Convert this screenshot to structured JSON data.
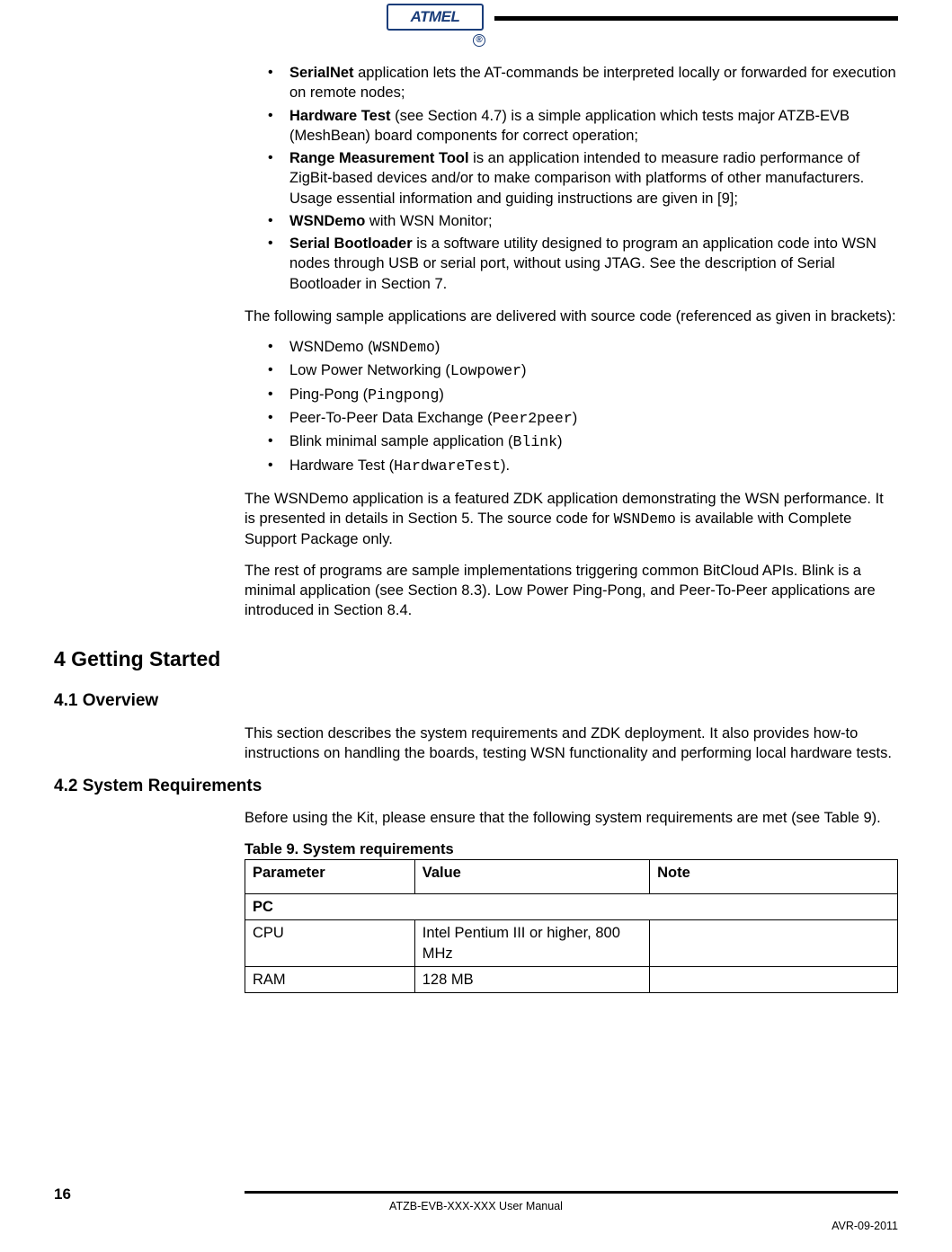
{
  "header": {
    "logo_text": "ATMEL",
    "trademark": "®"
  },
  "bullets_top": [
    {
      "bold": "SerialNet",
      "text": " application lets the AT-commands be interpreted locally or forwarded for execution on remote nodes;"
    },
    {
      "bold": "Hardware Test",
      "text": " (see Section 4.7) is a simple application which tests major ATZB-EVB (MeshBean) board components for correct operation;"
    },
    {
      "bold": "Range Measurement Tool",
      "text": " is an application intended to measure radio performance of ZigBit-based devices and/or to make comparison with platforms of other manufacturers. Usage essential information and guiding instructions are given in [9];"
    },
    {
      "bold": "WSNDemo",
      "text": " with WSN Monitor;"
    },
    {
      "bold": "Serial Bootloader",
      "text": " is a software utility designed to program an application code into WSN nodes through USB or serial port, without using JTAG. See the description of Serial Bootloader in Section 7."
    }
  ],
  "para_intro_samples": "The following sample applications are delivered with source code (referenced as given in brackets):",
  "bullets_samples": [
    {
      "pre": "WSNDemo (",
      "code": "WSNDemo",
      "post": ")"
    },
    {
      "pre": "Low Power Networking (",
      "code": "Lowpower",
      "post": ")"
    },
    {
      "pre": "Ping-Pong (",
      "code": "Pingpong",
      "post": ")"
    },
    {
      "pre": "Peer-To-Peer Data Exchange (",
      "code": "Peer2peer",
      "post": ")"
    },
    {
      "pre": "Blink minimal sample application (",
      "code": "Blink",
      "post": ")"
    },
    {
      "pre": "Hardware Test (",
      "code": "HardwareTest",
      "post": ")."
    }
  ],
  "para_wsndemo": {
    "pre": "The WSNDemo application is a featured ZDK application demonstrating the WSN performance. It is presented in details in Section 5. The source code for ",
    "code": "WSNDemo",
    "post": " is available with Complete Support Package only."
  },
  "para_rest": "The rest of programs are sample implementations triggering common BitCloud APIs. Blink is a minimal application (see Section 8.3). Low Power Ping-Pong, and Peer-To-Peer applications are introduced in Section 8.4.",
  "section4": {
    "title": "4 Getting Started",
    "s41": {
      "title": "4.1 Overview",
      "para": "This section describes the system requirements and ZDK deployment. It also provides how-to instructions on handling the boards, testing WSN functionality and performing local hardware tests."
    },
    "s42": {
      "title": "4.2 System Requirements",
      "para": "Before using the Kit, please ensure that the following system requirements are met (see Table 9).",
      "table_caption": "Table 9. System requirements",
      "columns": {
        "param": "Parameter",
        "value": "Value",
        "note": "Note"
      },
      "rows": [
        {
          "type": "span",
          "param": "PC"
        },
        {
          "type": "row",
          "param": "CPU",
          "value": "Intel Pentium III or higher, 800 MHz",
          "note": ""
        },
        {
          "type": "row",
          "param": "RAM",
          "value": "128 MB",
          "note": ""
        }
      ]
    }
  },
  "footer": {
    "page_number": "16",
    "center": "ATZB-EVB-XXX-XXX User Manual",
    "right": "AVR-09-2011"
  }
}
